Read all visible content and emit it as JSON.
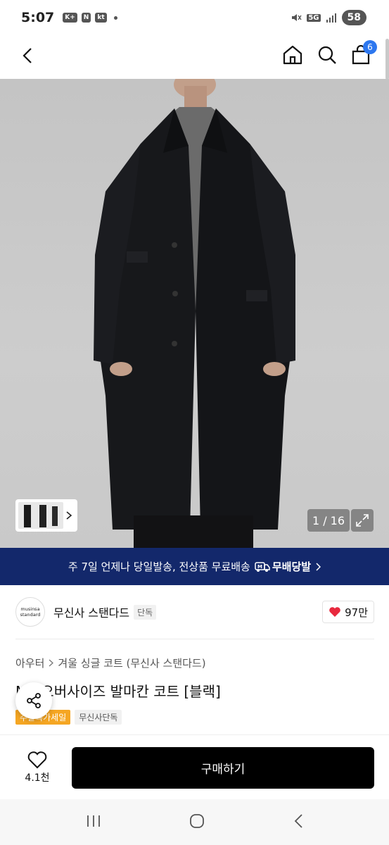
{
  "status_bar": {
    "time": "5:07",
    "chips": [
      "K+",
      "N",
      "kt"
    ],
    "network": "5G",
    "battery": "58"
  },
  "nav": {
    "cart_count": "6"
  },
  "image": {
    "counter": "1 / 16"
  },
  "promo": {
    "text": "주 7일 언제나 당일발송, 전상품 무료배송",
    "badge": "무배당발"
  },
  "brand": {
    "logo_line1": "musinsa",
    "logo_line2": "standard",
    "name": "무신사 스탠다드",
    "exclusive": "단독",
    "likes": "97만"
  },
  "product": {
    "breadcrumb": [
      "아우터",
      "겨울 싱글 코트 (무신사 스탠다드)"
    ],
    "title": "MS 오버사이즈 발마칸 코트 [블랙]",
    "tags": [
      "주말특가세일",
      "무신사단독"
    ]
  },
  "purchase": {
    "wish_count": "4.1천",
    "buy_label": "구매하기"
  },
  "colors": {
    "banner": "#13286b",
    "badge_blue": "#2d77ef",
    "heart": "#e8293e",
    "sale_tag": "#f5a623"
  }
}
